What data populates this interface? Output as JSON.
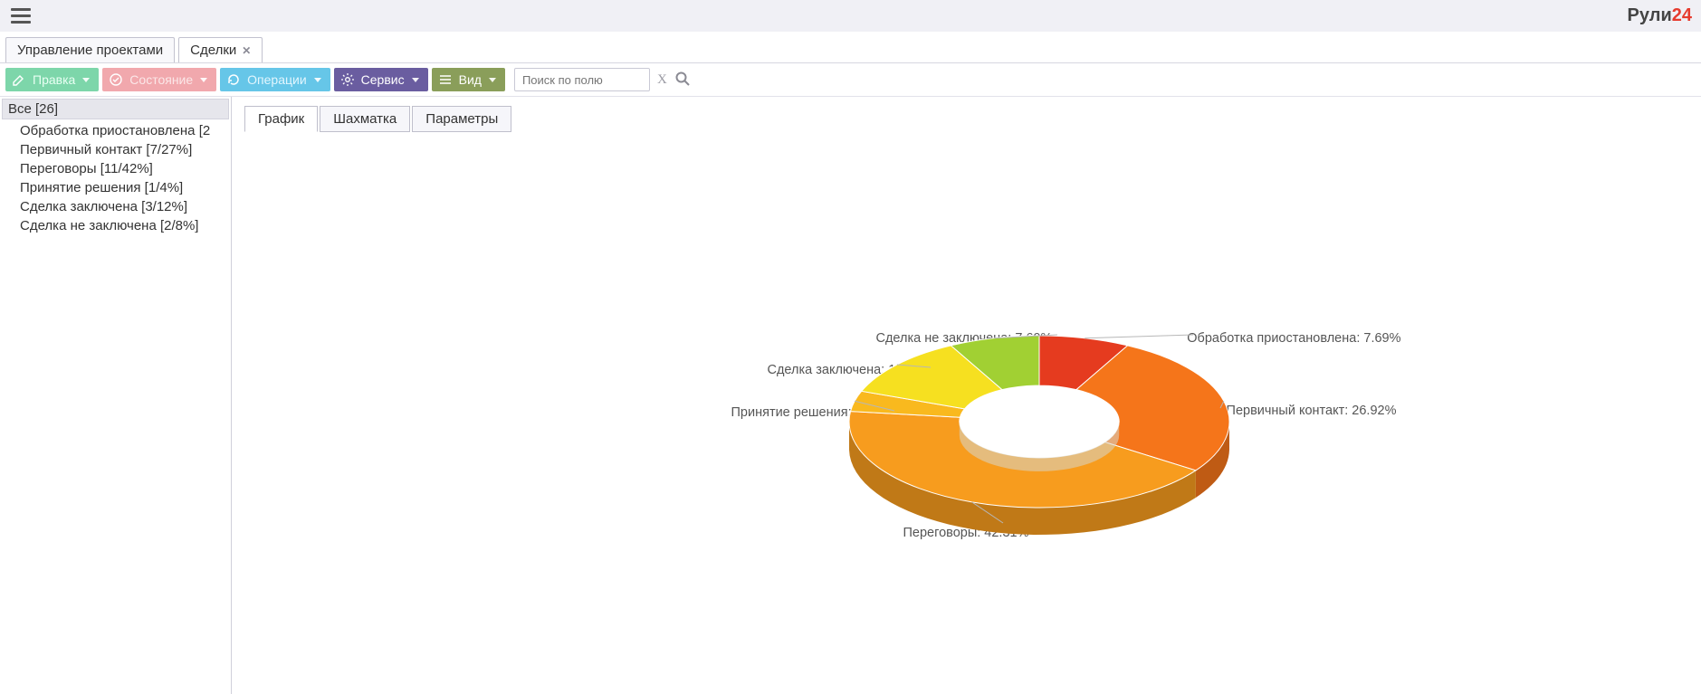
{
  "brand": {
    "prefix": "Рули",
    "suffix": "24"
  },
  "app_tabs": [
    {
      "label": "Управление проектами",
      "closable": false,
      "active": false
    },
    {
      "label": "Сделки",
      "closable": true,
      "active": true
    }
  ],
  "toolbar": {
    "edit": {
      "label": "Правка"
    },
    "status": {
      "label": "Состояние"
    },
    "ops": {
      "label": "Операции"
    },
    "service": {
      "label": "Сервис"
    },
    "view": {
      "label": "Вид"
    },
    "search_placeholder": "Поиск по полю",
    "clear": "X"
  },
  "sidebar": {
    "root": "Все [26]",
    "items": [
      "Обработка приостановлена [2",
      "Первичный контакт [7/27%]",
      "Переговоры [11/42%]",
      "Принятие решения [1/4%]",
      "Сделка заключена [3/12%]",
      "Сделка не заключена [2/8%]"
    ]
  },
  "view_tabs": [
    {
      "label": "График",
      "active": true
    },
    {
      "label": "Шахматка",
      "active": false
    },
    {
      "label": "Параметры",
      "active": false
    }
  ],
  "chart_labels": {
    "l0": "Обработка приостановлена: 7.69%",
    "l1": "Первичный контакт: 26.92%",
    "l2": "Переговоры: 42.31%",
    "l3": "Принятие решения: 3.85%",
    "l4": "Сделка заключена: 11.54%",
    "l5": "Сделка не заключена: 7.69%"
  },
  "chart_data": {
    "type": "pie",
    "title": "",
    "subtitle": "",
    "categories": [
      "Обработка приостановлена",
      "Первичный контакт",
      "Переговоры",
      "Принятие решения",
      "Сделка заключена",
      "Сделка не заключена"
    ],
    "values": [
      7.69,
      26.92,
      42.31,
      3.85,
      11.54,
      7.69
    ],
    "colors": [
      "#e53b1f",
      "#f5751a",
      "#f79c1e",
      "#f9b91e",
      "#f6e020",
      "#a1d033"
    ],
    "counts": [
      2,
      7,
      11,
      1,
      3,
      2
    ],
    "total": 26,
    "hole_ratio": 0.42,
    "tilt_deg": 35,
    "depth": 30
  }
}
